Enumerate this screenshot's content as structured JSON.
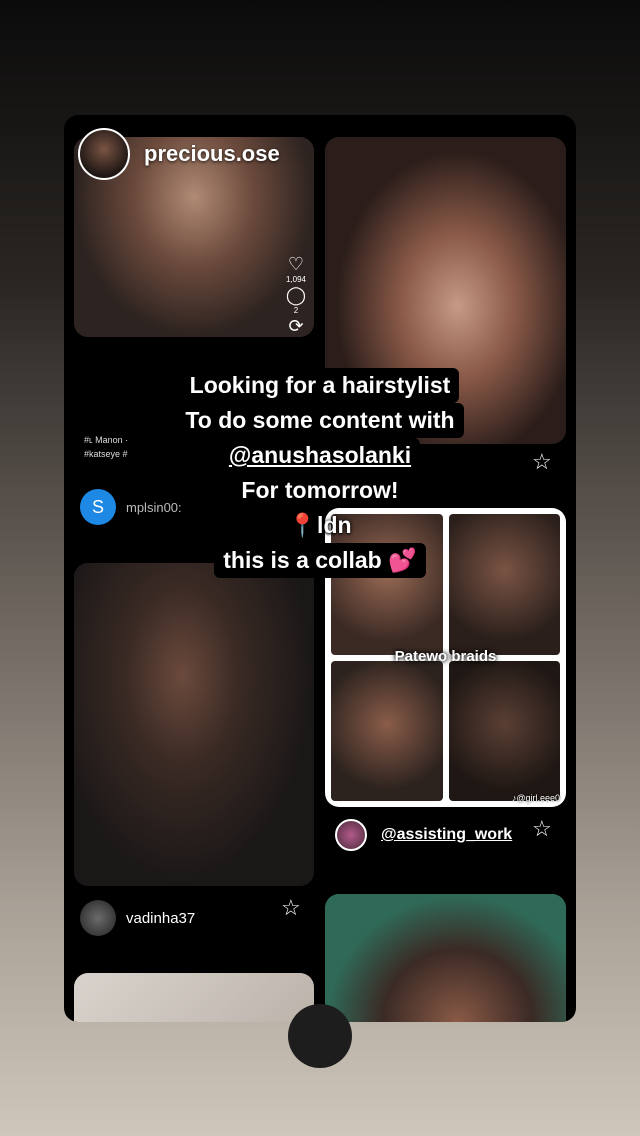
{
  "story": {
    "owner_name": "precious.ose",
    "overlay_lines": [
      "Looking for a hairstylist",
      "To do some content with",
      "@anushasolanki",
      "For tomorrow!",
      "📍ldn",
      "this is a collab 💕"
    ]
  },
  "pins": {
    "pin1": {
      "likes": "1,094",
      "comments": "2",
      "caption_line1": "#ʟ Manon ·",
      "caption_line2": "#katseye #"
    },
    "pin3": {
      "user_initial": "S",
      "user_name": "mplsin00:",
      "avatar_color": "#1e88e5"
    },
    "pin4": {
      "label": "Patewo braids",
      "watermark": "♪@girl.eee0",
      "mention": "@assisting_work"
    },
    "pin5": {
      "user_name": "vadinha37"
    }
  },
  "icons": {
    "star": "star-outline-icon",
    "heart": "heart-outline-icon",
    "comment": "comment-bubble-icon",
    "share": "repeat-icon"
  }
}
